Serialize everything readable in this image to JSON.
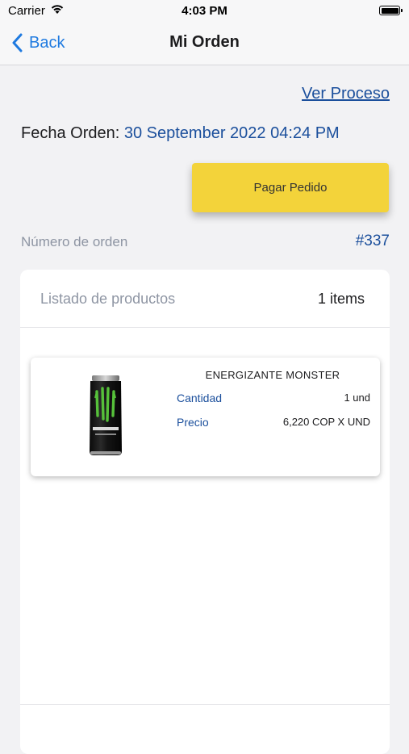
{
  "status_bar": {
    "carrier": "Carrier",
    "time": "4:03 PM"
  },
  "nav": {
    "back_label": "Back",
    "title": "Mi Orden"
  },
  "order": {
    "process_link": "Ver Proceso",
    "date_label": "Fecha Orden:",
    "date_value": "30 September 2022 04:24 PM",
    "pay_button": "Pagar Pedido",
    "number_label": "Número de orden",
    "number_value": "#337"
  },
  "products": {
    "title": "Listado de productos",
    "count": "1 items",
    "items": [
      {
        "name": "ENERGIZANTE MONSTER",
        "quantity_label": "Cantidad",
        "quantity_value": "1 und",
        "price_label": "Precio",
        "price_value": "6,220 COP X UND",
        "image_icon": "monster-energy-can"
      }
    ]
  },
  "colors": {
    "accent_blue": "#1b4f9c",
    "ios_blue": "#1f7ae0",
    "button_yellow": "#f3d33a",
    "background": "#f2f2f4"
  }
}
